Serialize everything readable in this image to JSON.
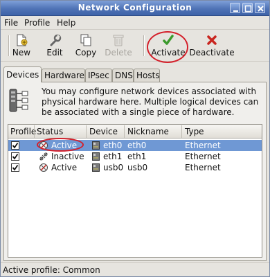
{
  "window": {
    "title": "Network Configuration"
  },
  "menubar": {
    "items": [
      "File",
      "Profile",
      "Help"
    ]
  },
  "toolbar": {
    "new_label": "New",
    "edit_label": "Edit",
    "copy_label": "Copy",
    "delete_label": "Delete",
    "activate_label": "Activate",
    "deactivate_label": "Deactivate"
  },
  "tabs": [
    "Devices",
    "Hardware",
    "IPsec",
    "DNS",
    "Hosts"
  ],
  "active_tab": "Devices",
  "devices_panel": {
    "description": "You may configure network devices associated with physical hardware here.  Multiple logical devices can be associated with a single piece of hardware.",
    "columns": [
      "Profile",
      "Status",
      "Device",
      "Nickname",
      "Type"
    ],
    "rows": [
      {
        "profile_checked": true,
        "status": "Active",
        "status_icon": "active-status-icon",
        "device": "eth0",
        "nickname": "eth0",
        "type": "Ethernet",
        "selected": true
      },
      {
        "profile_checked": true,
        "status": "Inactive",
        "status_icon": "inactive-status-icon",
        "device": "eth1",
        "nickname": "eth1",
        "type": "Ethernet",
        "selected": false
      },
      {
        "profile_checked": true,
        "status": "Active",
        "status_icon": "active-status-icon",
        "device": "usb0",
        "nickname": "usb0",
        "type": "Ethernet",
        "selected": false
      }
    ]
  },
  "statusbar": {
    "text": "Active profile: Common"
  },
  "colors": {
    "titlebar": "#4f73b6",
    "selection": "#6f98d4",
    "annotation_ring": "#d4202b"
  }
}
